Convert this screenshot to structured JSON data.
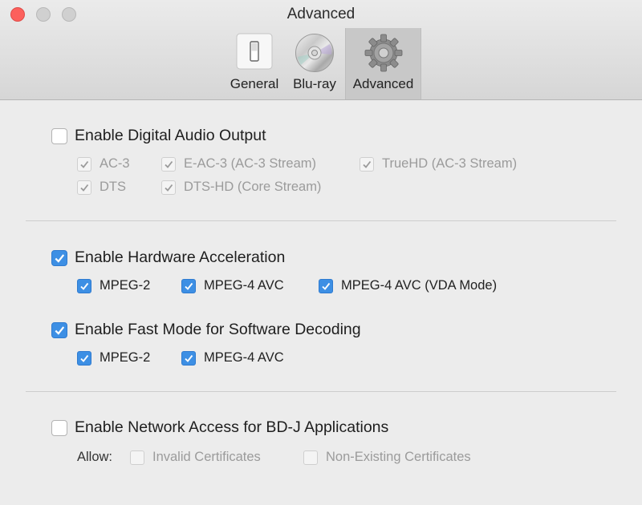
{
  "window": {
    "title": "Advanced"
  },
  "tabs": [
    {
      "label": "General",
      "icon": "switch-icon",
      "selected": false
    },
    {
      "label": "Blu-ray",
      "icon": "disc-icon",
      "selected": false
    },
    {
      "label": "Advanced",
      "icon": "gear-icon",
      "selected": true
    }
  ],
  "digital_audio": {
    "label": "Enable Digital Audio Output",
    "checked": false,
    "options": [
      {
        "label": "AC-3",
        "checked": true,
        "enabled": false
      },
      {
        "label": "E-AC-3 (AC-3 Stream)",
        "checked": true,
        "enabled": false
      },
      {
        "label": "TrueHD (AC-3 Stream)",
        "checked": true,
        "enabled": false
      },
      {
        "label": "DTS",
        "checked": true,
        "enabled": false
      },
      {
        "label": "DTS-HD (Core Stream)",
        "checked": true,
        "enabled": false
      }
    ]
  },
  "hw_accel": {
    "label": "Enable Hardware Acceleration",
    "checked": true,
    "options": [
      {
        "label": "MPEG-2",
        "checked": true,
        "enabled": true
      },
      {
        "label": "MPEG-4 AVC",
        "checked": true,
        "enabled": true
      },
      {
        "label": "MPEG-4 AVC (VDA Mode)",
        "checked": true,
        "enabled": true
      }
    ]
  },
  "fast_mode": {
    "label": "Enable Fast Mode for Software Decoding",
    "checked": true,
    "options": [
      {
        "label": "MPEG-2",
        "checked": true,
        "enabled": true
      },
      {
        "label": "MPEG-4 AVC",
        "checked": true,
        "enabled": true
      }
    ]
  },
  "network": {
    "label": "Enable Network Access for BD-J Applications",
    "checked": false,
    "allow_label": "Allow:",
    "options": [
      {
        "label": "Invalid Certificates",
        "checked": false,
        "enabled": false
      },
      {
        "label": "Non-Existing Certificates",
        "checked": false,
        "enabled": false
      }
    ]
  },
  "colors": {
    "accent": "#3d8fe4",
    "close_button": "#fc605c"
  }
}
